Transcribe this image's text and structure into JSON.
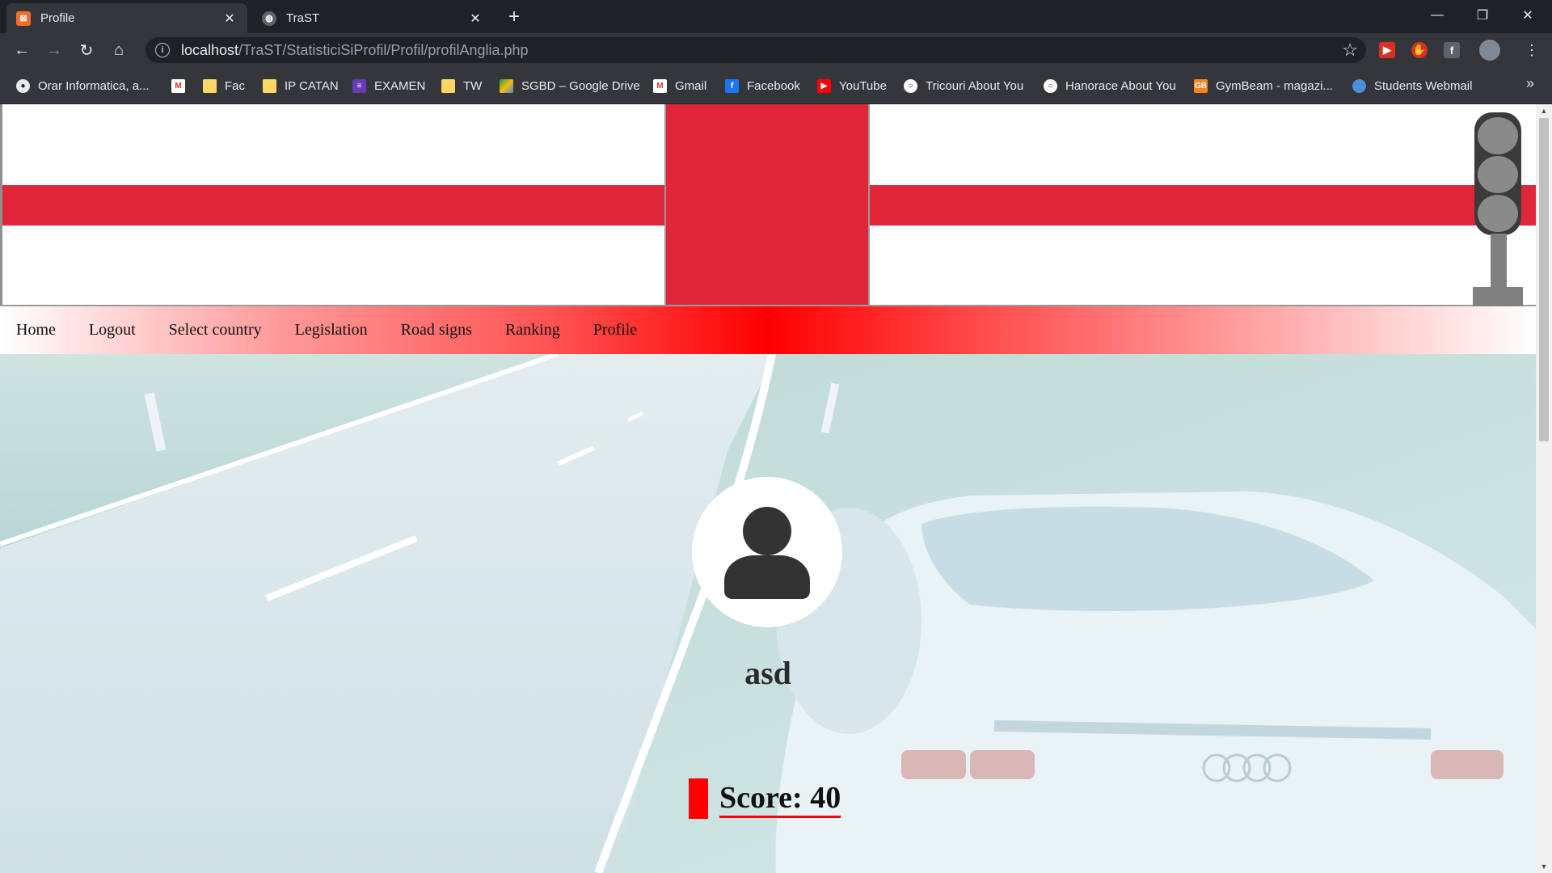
{
  "browser": {
    "tabs": [
      {
        "title": "Profile",
        "active": true,
        "favicon": "xampp-icon"
      },
      {
        "title": "TraST",
        "active": false,
        "favicon": "globe-icon"
      }
    ],
    "url_host": "localhost",
    "url_path": "/TraST/StatisticiSiProfil/Profil/profilAnglia.php",
    "bookmarks": [
      {
        "label": "Orar Informatica, a...",
        "icon": "globe-icon"
      },
      {
        "label": "",
        "icon": "gmail-icon"
      },
      {
        "label": "Fac",
        "icon": "folder-icon"
      },
      {
        "label": "IP CATAN",
        "icon": "folder-icon"
      },
      {
        "label": "EXAMEN",
        "icon": "list-icon"
      },
      {
        "label": "TW",
        "icon": "folder-icon"
      },
      {
        "label": "SGBD – Google Drive",
        "icon": "drive-icon"
      },
      {
        "label": "Gmail",
        "icon": "gmail-icon"
      },
      {
        "label": "Facebook",
        "icon": "facebook-icon"
      },
      {
        "label": "YouTube",
        "icon": "youtube-icon"
      },
      {
        "label": "Tricouri About You",
        "icon": "aboutyou-icon"
      },
      {
        "label": "Hanorace About You",
        "icon": "aboutyou-icon"
      },
      {
        "label": "GymBeam - magazi...",
        "icon": "gymbeam-icon"
      },
      {
        "label": "Students Webmail",
        "icon": "webmail-icon"
      }
    ]
  },
  "page": {
    "nav": [
      "Home",
      "Logout",
      "Select country",
      "Legislation",
      "Road signs",
      "Ranking",
      "Profile"
    ],
    "username": "asd",
    "score_text": "Score: 40",
    "score_value": 40,
    "colors": {
      "flag_red": "#e0273a",
      "nav_red": "#ff0000",
      "score_marker": "#ff0000"
    }
  }
}
